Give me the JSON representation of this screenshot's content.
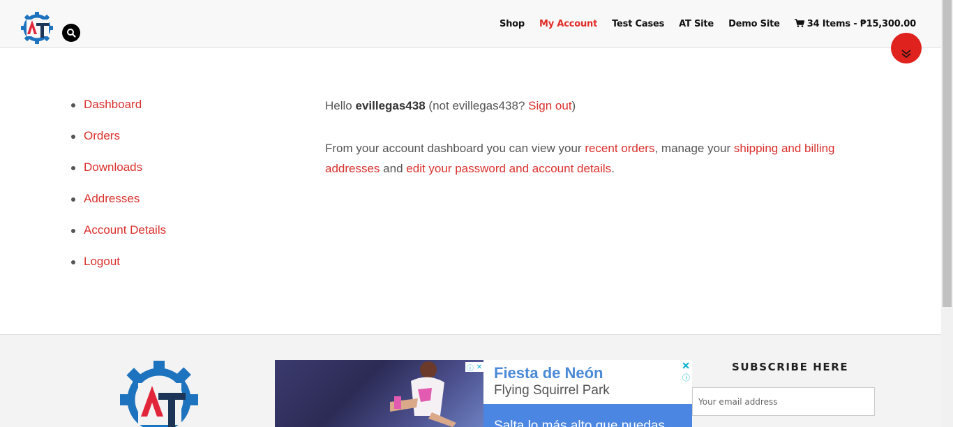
{
  "header": {
    "nav": [
      {
        "label": "Shop",
        "active": false
      },
      {
        "label": "My Account",
        "active": true
      },
      {
        "label": "Test Cases",
        "active": false
      },
      {
        "label": "AT Site",
        "active": false
      },
      {
        "label": "Demo Site",
        "active": false
      }
    ],
    "cart": {
      "label": "34 Items - ₱15,300.00",
      "icon": "cart-icon"
    }
  },
  "account_nav": [
    "Dashboard",
    "Orders",
    "Downloads",
    "Addresses",
    "Account Details",
    "Logout"
  ],
  "dashboard": {
    "hello": "Hello",
    "username": "evillegas438",
    "not_prefix": "(not",
    "not_user": "evillegas438?",
    "sign_out": "Sign out",
    "not_suffix": ")",
    "intro": "From your account dashboard you can view your",
    "recent_orders": "recent orders",
    "manage": ", manage your",
    "addresses_link": "shipping and billing addresses",
    "and": "and",
    "edit_link": "edit your password and account details",
    "period": "."
  },
  "ad": {
    "title": "Fiesta de Neón",
    "subtitle": "Flying Squirrel Park",
    "cta": "Salta lo más alto que puedas"
  },
  "subscribe": {
    "title": "SUBSCRIBE HERE",
    "placeholder": "Your email address"
  },
  "colors": {
    "accent": "#e02b27",
    "link": "#d9302c",
    "logo_blue": "#1e73be",
    "logo_red": "#e2263a",
    "logo_navy": "#1c3557"
  }
}
